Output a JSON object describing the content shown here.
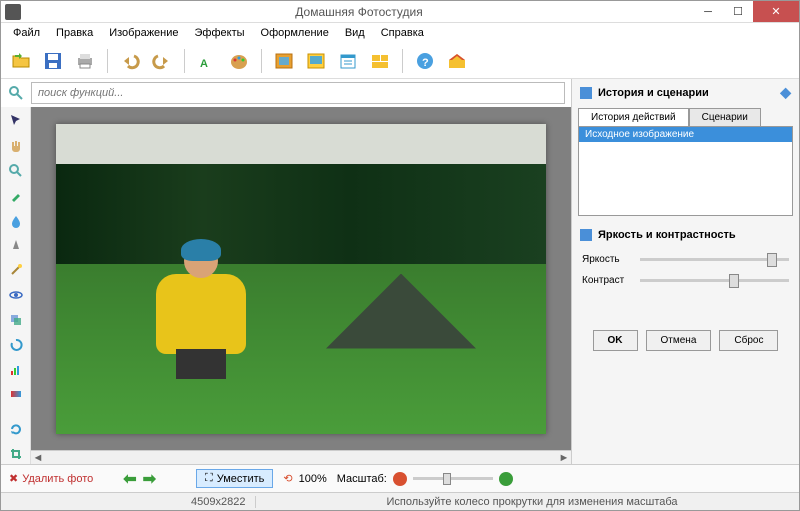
{
  "window": {
    "title": "Домашняя Фотостудия"
  },
  "menu": {
    "file": "Файл",
    "edit": "Правка",
    "image": "Изображение",
    "effects": "Эффекты",
    "design": "Оформление",
    "view": "Вид",
    "help": "Справка"
  },
  "search": {
    "placeholder": "поиск функций..."
  },
  "right": {
    "history_title": "История и сценарии",
    "tab_history": "История действий",
    "tab_scenarios": "Сценарии",
    "history_item": "Исходное изображение",
    "bc_title": "Яркость и контрастность",
    "brightness": "Яркость",
    "contrast": "Контраст",
    "ok": "OK",
    "cancel": "Отмена",
    "reset": "Сброс"
  },
  "bottom": {
    "delete": "Удалить фото",
    "fit": "Уместить",
    "zoom_pct": "100%",
    "scale_label": "Масштаб:"
  },
  "status": {
    "dims": "4509x2822",
    "hint": "Используйте колесо прокрутки для изменения масштаба"
  },
  "icons": {
    "open": "open-icon",
    "save": "save-icon",
    "print": "print-icon",
    "undo": "undo-icon",
    "redo": "redo-icon",
    "text": "text-icon",
    "palette": "palette-icon",
    "frame": "frame-icon",
    "photo": "photo-icon",
    "calendar": "calendar-icon",
    "collage": "collage-icon",
    "help": "help-icon",
    "home": "home-icon"
  }
}
